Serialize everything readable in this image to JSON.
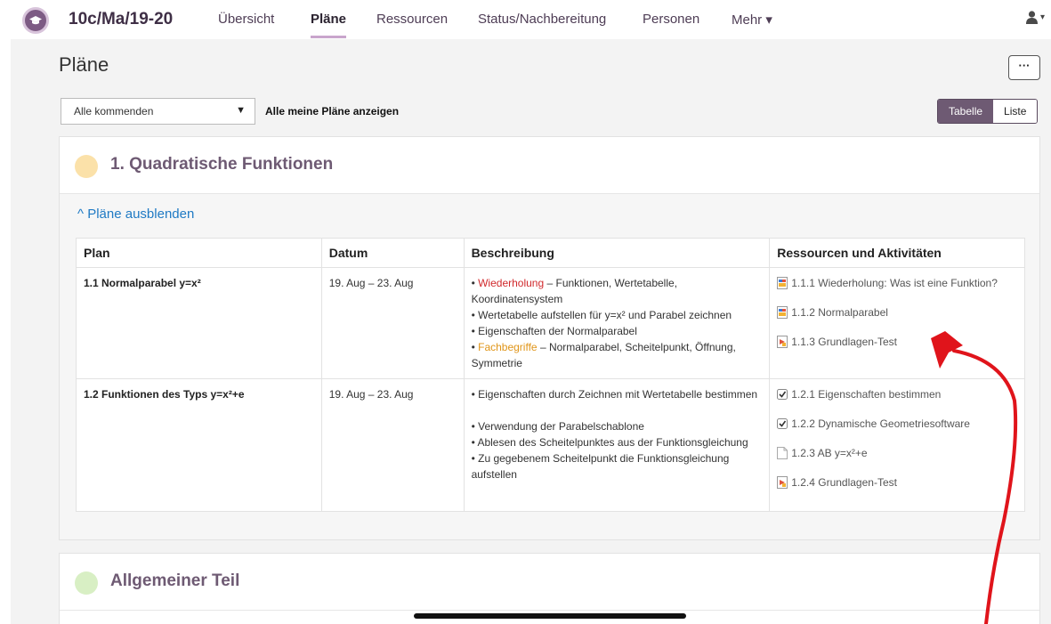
{
  "nav": {
    "course": "10c/Ma/19-20",
    "items": [
      "Übersicht",
      "Pläne",
      "Ressourcen",
      "Status/Nachbereitung",
      "Personen",
      "Mehr ▾"
    ],
    "active": "Pläne",
    "user_caret": "▾"
  },
  "page": {
    "title": "Pläne",
    "more_label": "···",
    "filter_value": "Alle kommenden",
    "show_all_label": "Alle meine Pläne anzeigen",
    "view_toggle": [
      "Tabelle",
      "Liste"
    ],
    "view_active": "Tabelle"
  },
  "sections": [
    {
      "title": "1. Quadratische Funktionen",
      "dot_color": "#fbe1a9",
      "hide_label": "^ Pläne ausblenden",
      "columns": [
        "Plan",
        "Datum",
        "Beschreibung",
        "Ressourcen und Aktivitäten"
      ],
      "rows": [
        {
          "plan": "1.1 Normalparabel y=x²",
          "date": "19. Aug – 23. Aug",
          "desc": [
            {
              "hl": "Wiederholung",
              "hl_color": "red",
              "text": " – Funktionen, Wertetabelle, Koordinatensystem"
            },
            {
              "text": "Wertetabelle aufstellen für y=x² und Parabel zeichnen"
            },
            {
              "text": "Eigenschaften der Normalparabel"
            },
            {
              "hl": "Fachbegriffe",
              "hl_color": "orange",
              "text": " – Normalparabel, Scheitelpunkt, Öffnung, Symmetrie"
            }
          ],
          "resources": [
            {
              "icon": "presentation-icon",
              "label": "1.1.1 Wiederholung: Was ist eine Funktion?"
            },
            {
              "icon": "presentation-icon",
              "label": "1.1.2 Normalparabel"
            },
            {
              "icon": "quiz-icon",
              "label": "1.1.3 Grundlagen-Test"
            }
          ]
        },
        {
          "plan": "1.2 Funktionen des Typs y=x²+e",
          "date": "19. Aug – 23. Aug",
          "desc": [
            {
              "text": "Eigenschaften durch Zeichnen mit Wertetabelle bestimmen"
            },
            {
              "text": ""
            },
            {
              "text": "Verwendung der Parabelschablone"
            },
            {
              "text": "Ablesen des Scheitelpunktes aus der Funktionsgleichung"
            },
            {
              "text": "Zu gegebenem Scheitelpunkt die Funktionsgleichung aufstellen"
            }
          ],
          "resources": [
            {
              "icon": "checkbox-icon",
              "label": "1.2.1 Eigenschaften bestimmen"
            },
            {
              "icon": "checkbox-icon",
              "label": "1.2.2 Dynamische Geometriesoftware"
            },
            {
              "icon": "document-icon",
              "label": "1.2.3 AB y=x²+e"
            },
            {
              "icon": "quiz-icon",
              "label": "1.2.4 Grundlagen-Test"
            }
          ]
        }
      ]
    },
    {
      "title": "Allgemeiner Teil",
      "dot_color": "#d8efc4"
    }
  ],
  "annotation": {
    "color": "#e0141b"
  }
}
